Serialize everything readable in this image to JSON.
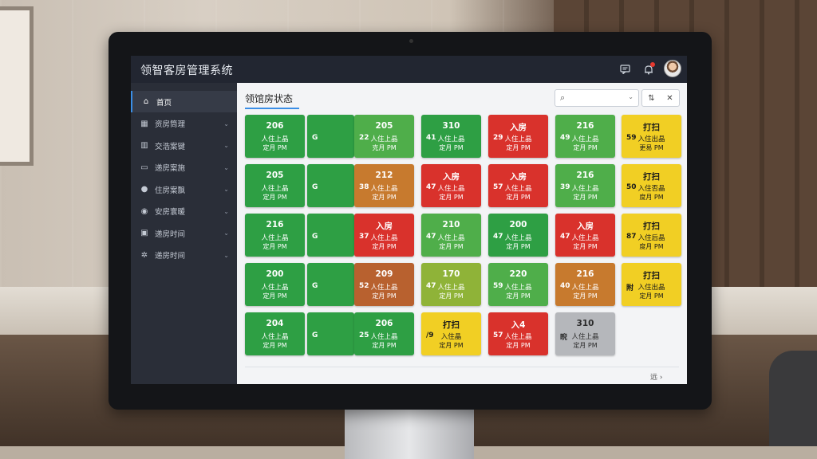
{
  "app": {
    "title": "领智客房管理系统"
  },
  "topbar": {
    "message_icon": "message-icon",
    "bell_icon": "bell-icon"
  },
  "sidebar": {
    "items": [
      {
        "label": "首页",
        "icon": "⌂",
        "active": true,
        "chevron": ""
      },
      {
        "label": "资房筒理",
        "icon": "▦",
        "chevron": "⌄"
      },
      {
        "label": "交浩案键",
        "icon": "▥",
        "chevron": "⌄"
      },
      {
        "label": "递房案施",
        "icon": "▭",
        "chevron": "⌄"
      },
      {
        "label": "住房案飘",
        "icon": "●",
        "chevron": "⌄"
      },
      {
        "label": "安房寰暖",
        "icon": "◉",
        "chevron": "⌄"
      },
      {
        "label": "递房时间",
        "icon": "▣",
        "chevron": "⌄"
      },
      {
        "label": "递房时间",
        "icon": "✲",
        "chevron": "⌄"
      }
    ]
  },
  "main": {
    "title": "领馆房状态",
    "search": {
      "placeholder": "",
      "icon": "⌕",
      "chevron": "⌄"
    },
    "tools": {
      "filter": "⇅",
      "close": "✕"
    },
    "pager": "远 ›"
  },
  "rooms": [
    [
      {
        "top": "206",
        "mid": "人住上晶",
        "bot": "定月 PM",
        "side": "",
        "color": "green"
      },
      {
        "top": "",
        "mid": "",
        "bot": "",
        "side": "G",
        "color": "green",
        "narrow": true
      },
      {
        "top": "205",
        "mid": "人住上晶",
        "bot": "克月 PM",
        "side": "22",
        "color": "lgreen"
      },
      {
        "top": "310",
        "mid": "人住上晶",
        "bot": "定月 PM",
        "side": "41",
        "color": "green"
      },
      {
        "top": "入房",
        "mid": "人住上晶",
        "bot": "定月 PM",
        "side": "29",
        "color": "red"
      },
      {
        "top": "216",
        "mid": "人住上晶",
        "bot": "定月 PM",
        "side": "49",
        "color": "lgreen"
      },
      {
        "top": "打扫",
        "mid": "入住出晶",
        "bot": "更易 PM",
        "side": "59",
        "color": "yellow"
      }
    ],
    [
      {
        "top": "205",
        "mid": "人往上晶",
        "bot": "定月 PM",
        "side": "",
        "color": "green"
      },
      {
        "top": "",
        "mid": "",
        "bot": "",
        "side": "G",
        "color": "green",
        "narrow": true
      },
      {
        "top": "212",
        "mid": "人住上晶",
        "bot": "定月 PM",
        "side": "38",
        "color": "orange"
      },
      {
        "top": "入房",
        "mid": "人住上晶",
        "bot": "定月 PM",
        "side": "47",
        "color": "red"
      },
      {
        "top": "入房",
        "mid": "人住上晶",
        "bot": "定月 PM",
        "side": "57",
        "color": "red"
      },
      {
        "top": "216",
        "mid": "人住上晶",
        "bot": "定月 PM",
        "side": "39",
        "color": "lgreen"
      },
      {
        "top": "打扫",
        "mid": "入住否晶",
        "bot": "度月 PM",
        "side": "50",
        "color": "yellow"
      }
    ],
    [
      {
        "top": "216",
        "mid": "人住上晶",
        "bot": "定月 PM",
        "side": "",
        "color": "green"
      },
      {
        "top": "",
        "mid": "",
        "bot": "",
        "side": "G",
        "color": "green",
        "narrow": true
      },
      {
        "top": "入房",
        "mid": "人住上晶",
        "bot": "定月 PM",
        "side": "37",
        "color": "red"
      },
      {
        "top": "210",
        "mid": "人住上晶",
        "bot": "定月 PM",
        "side": "47",
        "color": "lgreen"
      },
      {
        "top": "200",
        "mid": "人住上晶",
        "bot": "定月 PM",
        "side": "47",
        "color": "green"
      },
      {
        "top": "入房",
        "mid": "人住上晶",
        "bot": "定月 PM",
        "side": "47",
        "color": "red"
      },
      {
        "top": "打扫",
        "mid": "入住后晶",
        "bot": "度月 PM",
        "side": "87",
        "color": "yellow"
      }
    ],
    [
      {
        "top": "200",
        "mid": "人住上晶",
        "bot": "定月 PM",
        "side": "",
        "color": "green"
      },
      {
        "top": "",
        "mid": "",
        "bot": "",
        "side": "G",
        "color": "green",
        "narrow": true
      },
      {
        "top": "209",
        "mid": "人住上晶",
        "bot": "定月 PM",
        "side": "52",
        "color": "brown"
      },
      {
        "top": "170",
        "mid": "人住上晶",
        "bot": "定月 PM",
        "side": "47",
        "color": "olive"
      },
      {
        "top": "220",
        "mid": "人住上晶",
        "bot": "定月 PM",
        "side": "59",
        "color": "lgreen"
      },
      {
        "top": "216",
        "mid": "人住上晶",
        "bot": "定月 PM",
        "side": "40",
        "color": "orange"
      },
      {
        "top": "打扫",
        "mid": "入住出晶",
        "bot": "定月 PM",
        "side": "附",
        "color": "yellow"
      }
    ],
    [
      {
        "top": "204",
        "mid": "人住上晶",
        "bot": "定月 PM",
        "side": "",
        "color": "green"
      },
      {
        "top": "",
        "mid": "",
        "bot": "",
        "side": "G",
        "color": "green",
        "narrow": true
      },
      {
        "top": "206",
        "mid": "人住上晶",
        "bot": "定月 PM",
        "side": "25",
        "color": "green"
      },
      {
        "top": "打扫",
        "mid": "入住晶",
        "bot": "定月 PM",
        "side": "/9",
        "color": "yellow"
      },
      {
        "top": "入4",
        "mid": "人住上晶",
        "bot": "定月 PM",
        "side": "57",
        "color": "red"
      },
      {
        "top": "310",
        "mid": "人住上晶",
        "bot": "定月 PM",
        "side": "睨",
        "color": "gray"
      }
    ]
  ]
}
